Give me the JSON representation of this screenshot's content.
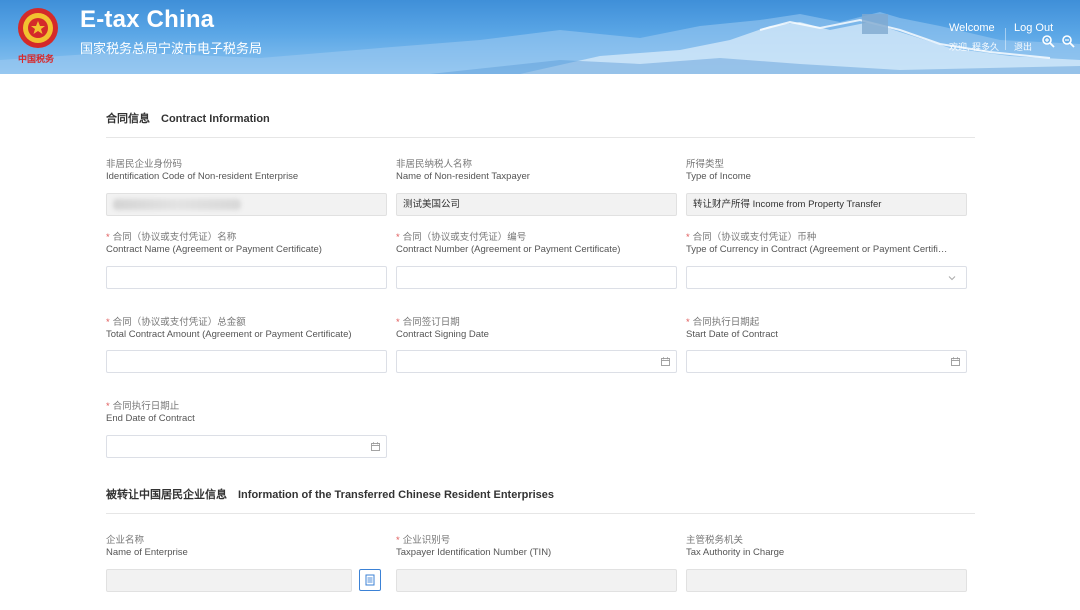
{
  "header": {
    "title": "E-tax China",
    "subtitle": "国家税务总局宁波市电子税务局",
    "emblem_caption": "中国税务",
    "welcome_en": "Welcome",
    "welcome_cn": "欢迎, 程多久",
    "logout_en": "Log Out",
    "logout_cn": "退出",
    "icons": [
      "zoom-in-icon",
      "zoom-out-icon"
    ]
  },
  "sections": {
    "contract": {
      "title_cn": "合同信息",
      "title_en": "Contract Information"
    },
    "transferred": {
      "title_cn": "被转让中国居民企业信息",
      "title_en": "Information of the Transferred Chinese Resident Enterprises"
    }
  },
  "fields": {
    "id_code": {
      "label_cn": "非居民企业身份码",
      "label_en": "Identification Code of Non-resident Enterprise",
      "value": ""
    },
    "taxpayer_name": {
      "label_cn": "非居民纳税人名称",
      "label_en": "Name of Non-resident Taxpayer",
      "value": "测试美国公司"
    },
    "income_type": {
      "label_cn": "所得类型",
      "label_en": "Type of Income",
      "value": "转让财产所得 Income from Property Transfer"
    },
    "contract_name": {
      "required": "*",
      "label_cn": "合同（协议或支付凭证）名称",
      "label_en": "Contract Name (Agreement or Payment Certificate)",
      "value": ""
    },
    "contract_number": {
      "required": "*",
      "label_cn": "合同（协议或支付凭证）编号",
      "label_en": "Contract Number (Agreement or Payment Certificate)",
      "value": ""
    },
    "currency": {
      "required": "*",
      "label_cn": "合同（协议或支付凭证）币种",
      "label_en": "Type of Currency in Contract (Agreement or Payment Certifi…",
      "value": ""
    },
    "total_amount": {
      "required": "*",
      "label_cn": "合同（协议或支付凭证）总金额",
      "label_en": "Total Contract Amount (Agreement or Payment Certificate)",
      "value": ""
    },
    "signing_date": {
      "required": "*",
      "label_cn": "合同签订日期",
      "label_en": "Contract Signing Date",
      "value": ""
    },
    "start_date": {
      "required": "*",
      "label_cn": "合同执行日期起",
      "label_en": "Start Date of Contract",
      "value": ""
    },
    "end_date": {
      "required": "*",
      "label_cn": "合同执行日期止",
      "label_en": "End Date of Contract",
      "value": ""
    },
    "enterprise_name": {
      "label_cn": "企业名称",
      "label_en": "Name of Enterprise",
      "value": ""
    },
    "tin": {
      "required": "*",
      "label_cn": "企业识别号",
      "label_en": "Taxpayer Identification Number (TIN)",
      "value": ""
    },
    "tax_authority": {
      "label_cn": "主管税务机关",
      "label_en": "Tax Authority in Charge",
      "value": ""
    }
  },
  "colors": {
    "header_blue": "#4b9be0",
    "required_red": "#e05a5a",
    "accent_blue": "#3b82d6"
  }
}
